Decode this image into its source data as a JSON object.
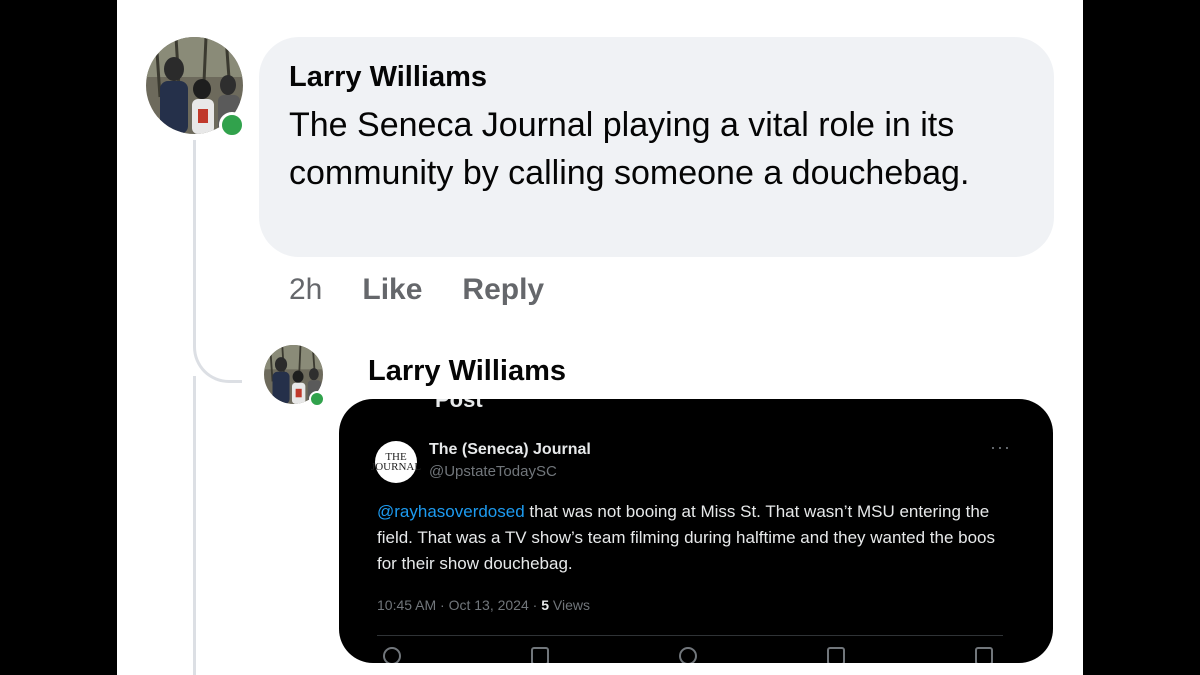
{
  "comment": {
    "author": "Larry Williams",
    "text": "The Seneca Journal playing a vital role in its community by calling someone a douchebag.",
    "time": "2h",
    "like_label": "Like",
    "reply_label": "Reply"
  },
  "reply": {
    "author": "Larry Williams"
  },
  "tweet": {
    "cut_header": "Post",
    "logo_text": "THE JOURNAL",
    "name": "The (Seneca) Journal",
    "handle": "@UpstateTodaySC",
    "more": "···",
    "mention": "@rayhasoverdosed",
    "body": " that was not booing at Miss St. That wasn’t MSU entering the field. That was a TV show’s team filming during halftime and they wanted the boos for their show douchebag.",
    "meta_time": "10:45 AM · Oct 13, 2024 · ",
    "views_count": "5",
    "views_label": " Views"
  },
  "colors": {
    "online": "#31a24c",
    "bubble": "#f0f2f5",
    "mention": "#1d9bf0"
  }
}
